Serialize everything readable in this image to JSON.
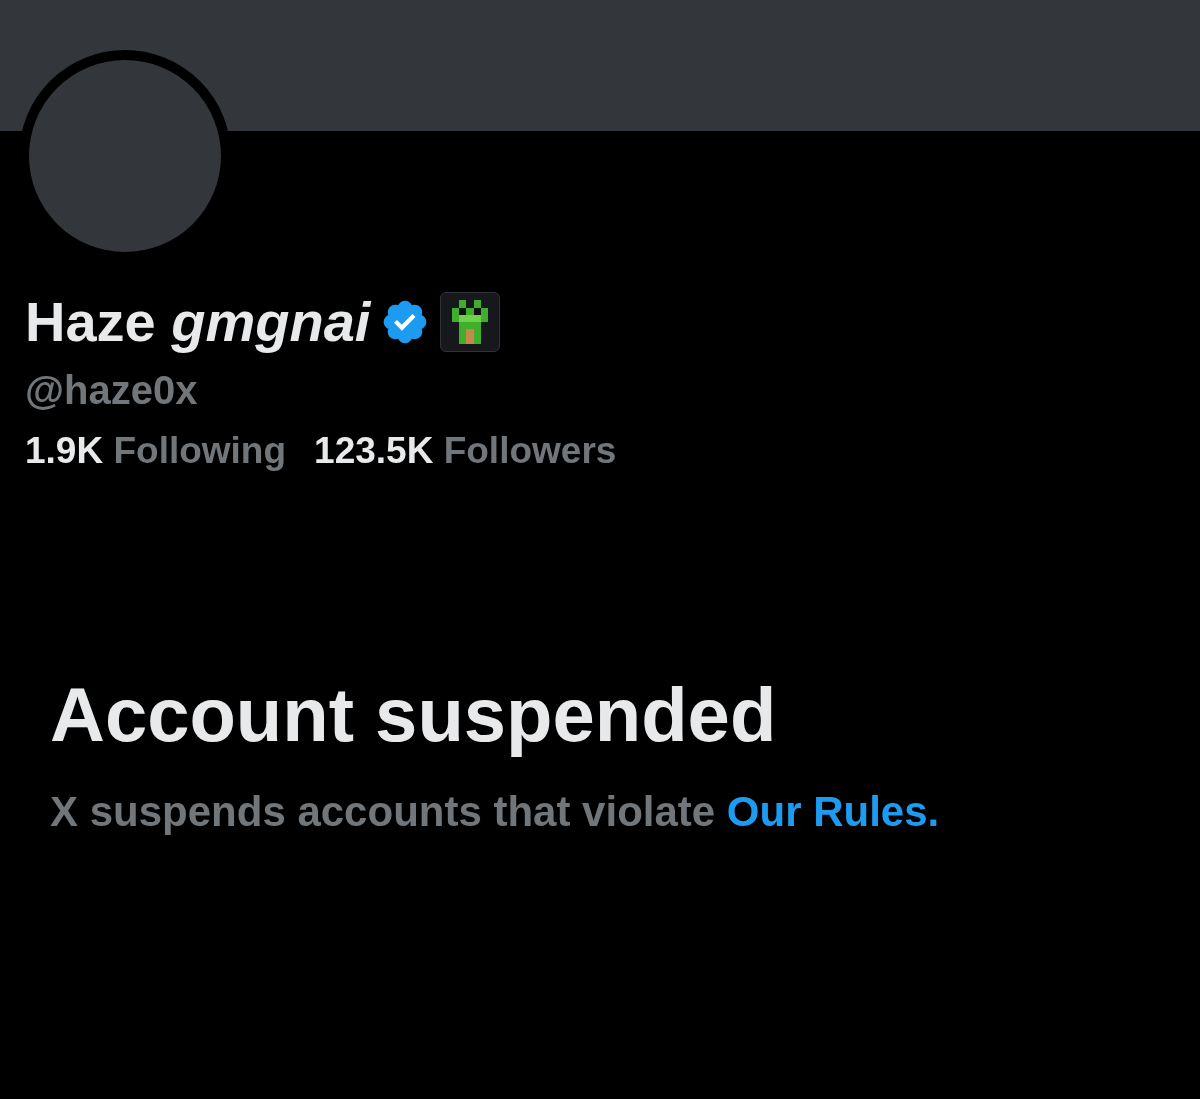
{
  "profile": {
    "display_name": "Haze *gmgnai*",
    "verified": true,
    "handle": "@haze0x",
    "stats": [
      {
        "count": "1.9K",
        "label": "Following"
      },
      {
        "count": "123.5K",
        "label": "Followers"
      }
    ]
  },
  "notice": {
    "title": "Account suspended",
    "text": "X suspends accounts that violate",
    "link": "Our Rules."
  }
}
